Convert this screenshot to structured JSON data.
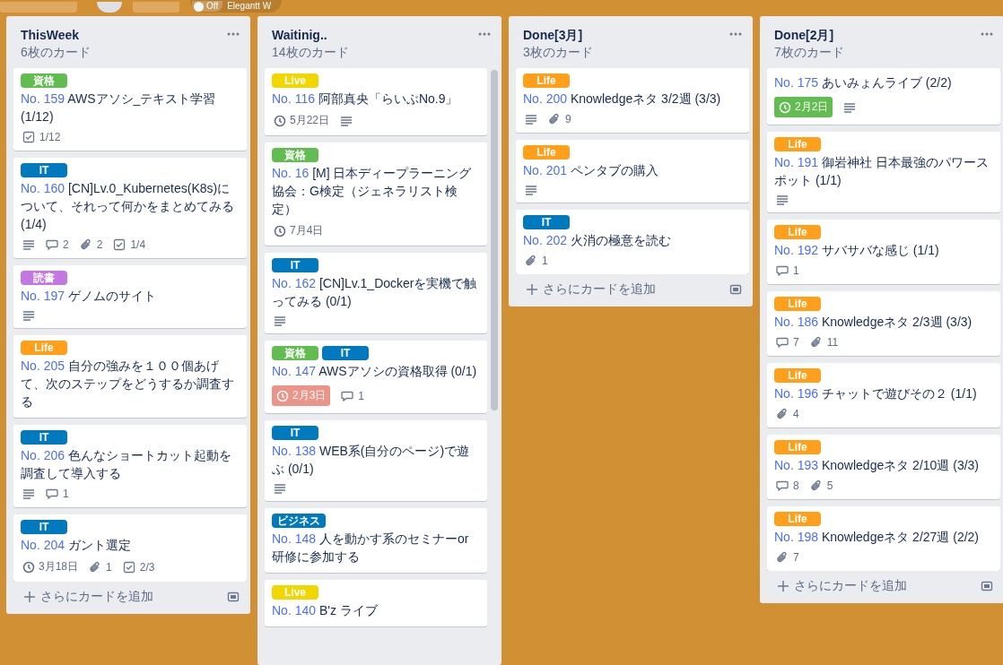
{
  "topbar": {
    "toggle": {
      "on": false,
      "state_text": "Off",
      "label": "Elegantt W"
    }
  },
  "lists": [
    {
      "title": "ThisWeek",
      "count": "6枚のカード",
      "add_card": "さらにカードを追加",
      "scrollable": false,
      "cards": [
        {
          "labels": [
            {
              "text": "資格",
              "color": "#61bd4f"
            }
          ],
          "number": "No. 159",
          "title": "AWSアソシ_テキスト学習 (1/12)",
          "badges": [
            {
              "kind": "checklist",
              "text": "1/12"
            }
          ]
        },
        {
          "labels": [
            {
              "text": "IT",
              "color": "#0079bf"
            }
          ],
          "number": "No. 160",
          "title": "[CN]Lv.0_Kubernetes(K8s)について、それって何かをまとめてみる (1/4)",
          "badges": [
            {
              "kind": "description"
            },
            {
              "kind": "comments",
              "text": "2"
            },
            {
              "kind": "attachments",
              "text": "2"
            },
            {
              "kind": "checklist",
              "text": "1/4"
            }
          ]
        },
        {
          "labels": [
            {
              "text": "読書",
              "color": "#c377e0"
            }
          ],
          "number": "No. 197",
          "title": "ゲノムのサイト",
          "badges": [
            {
              "kind": "description"
            }
          ]
        },
        {
          "labels": [
            {
              "text": "Life",
              "color": "#ff9f1a"
            }
          ],
          "number": "No. 205",
          "title": "自分の強みを１００個あげて、次のステップをどうするか調査する"
        },
        {
          "labels": [
            {
              "text": "IT",
              "color": "#0079bf"
            }
          ],
          "number": "No. 206",
          "title": "色んなショートカット起動を調査して導入する",
          "badges": [
            {
              "kind": "description"
            },
            {
              "kind": "comments",
              "text": "1"
            }
          ]
        },
        {
          "labels": [
            {
              "text": "IT",
              "color": "#0079bf"
            }
          ],
          "number": "No. 204",
          "title": "ガント選定",
          "badges": [
            {
              "kind": "due",
              "text": "3月18日"
            },
            {
              "kind": "attachments",
              "text": "1"
            },
            {
              "kind": "checklist",
              "text": "2/3"
            }
          ]
        }
      ]
    },
    {
      "title": "Waitinig..",
      "count": "14枚のカード",
      "scrollable": true,
      "cards": [
        {
          "labels": [
            {
              "text": "Live",
              "color": "#f2d600"
            }
          ],
          "number": "No. 116",
          "title": "阿部真央「らいぶNo.9」",
          "badges": [
            {
              "kind": "due",
              "text": "5月22日"
            },
            {
              "kind": "description"
            }
          ]
        },
        {
          "labels": [
            {
              "text": "資格",
              "color": "#61bd4f"
            }
          ],
          "number": "No. 16",
          "title": "[M] 日本ディープラーニング協会：G検定（ジェネラリスト検定）",
          "badges": [
            {
              "kind": "due",
              "text": "7月4日"
            }
          ]
        },
        {
          "labels": [
            {
              "text": "IT",
              "color": "#0079bf"
            }
          ],
          "number": "No. 162",
          "title": "[CN]Lv.1_Dockerを実機で触ってみる (0/1)",
          "badges": [
            {
              "kind": "description"
            }
          ]
        },
        {
          "labels": [
            {
              "text": "資格",
              "color": "#61bd4f"
            },
            {
              "text": "IT",
              "color": "#0079bf"
            }
          ],
          "number": "No. 147",
          "title": "AWSアソシの資格取得 (0/1)",
          "badges": [
            {
              "kind": "due_overdue",
              "text": "2月3日"
            },
            {
              "kind": "comments",
              "text": "1"
            }
          ]
        },
        {
          "labels": [
            {
              "text": "IT",
              "color": "#0079bf"
            }
          ],
          "number": "No. 138",
          "title": "WEB系(自分のページ)で遊ぶ (0/1)",
          "badges": [
            {
              "kind": "description"
            }
          ]
        },
        {
          "labels": [
            {
              "text": "ビジネス",
              "color": "#0079bf"
            }
          ],
          "number": "No. 148",
          "title": "人を動かす系のセミナーor研修に参加する"
        },
        {
          "labels": [
            {
              "text": "Live",
              "color": "#f2d600"
            }
          ],
          "number": "No. 140",
          "title": "B'z ライブ"
        }
      ]
    },
    {
      "title": "Done[3月]",
      "count": "3枚のカード",
      "add_card": "さらにカードを追加",
      "scrollable": false,
      "cards": [
        {
          "labels": [
            {
              "text": "Life",
              "color": "#ff9f1a"
            }
          ],
          "number": "No. 200",
          "title": "Knowledgeネタ 3/2週 (3/3)",
          "badges": [
            {
              "kind": "description"
            },
            {
              "kind": "attachments",
              "text": "9"
            }
          ]
        },
        {
          "labels": [
            {
              "text": "Life",
              "color": "#ff9f1a"
            }
          ],
          "number": "No. 201",
          "title": "ペンタブの購入",
          "badges": [
            {
              "kind": "description"
            }
          ]
        },
        {
          "labels": [
            {
              "text": "IT",
              "color": "#0079bf"
            }
          ],
          "number": "No. 202",
          "title": "火消の極意を読む",
          "badges": [
            {
              "kind": "attachments",
              "text": "1"
            }
          ]
        }
      ]
    },
    {
      "title": "Done[2月]",
      "count": "7枚のカード",
      "add_card": "さらにカードを追加",
      "scrollable": false,
      "cards": [
        {
          "number": "No. 175",
          "title": "あいみょんライブ (2/2)",
          "badges": [
            {
              "kind": "due_complete",
              "text": "2月2日"
            },
            {
              "kind": "description"
            }
          ]
        },
        {
          "labels": [
            {
              "text": "Life",
              "color": "#ff9f1a"
            }
          ],
          "number": "No. 191",
          "title": "御岩神社 日本最強のパワースポット (1/1)",
          "badges": [
            {
              "kind": "description"
            }
          ]
        },
        {
          "labels": [
            {
              "text": "Life",
              "color": "#ff9f1a"
            }
          ],
          "number": "No. 192",
          "title": "サバサバな感じ (1/1)",
          "badges": [
            {
              "kind": "comments",
              "text": "1"
            }
          ]
        },
        {
          "labels": [
            {
              "text": "Life",
              "color": "#ff9f1a"
            }
          ],
          "number": "No. 186",
          "title": "Knowledgeネタ 2/3週 (3/3)",
          "badges": [
            {
              "kind": "comments",
              "text": "7"
            },
            {
              "kind": "attachments",
              "text": "11"
            }
          ]
        },
        {
          "labels": [
            {
              "text": "Life",
              "color": "#ff9f1a"
            }
          ],
          "number": "No. 196",
          "title": "チャットで遊びその２ (1/1)",
          "badges": [
            {
              "kind": "attachments",
              "text": "4"
            }
          ]
        },
        {
          "labels": [
            {
              "text": "Life",
              "color": "#ff9f1a"
            }
          ],
          "number": "No. 193",
          "title": "Knowledgeネタ 2/10週 (3/3)",
          "badges": [
            {
              "kind": "comments",
              "text": "8"
            },
            {
              "kind": "attachments",
              "text": "5"
            }
          ]
        },
        {
          "labels": [
            {
              "text": "Life",
              "color": "#ff9f1a"
            }
          ],
          "number": "No. 198",
          "title": "Knowledgeネタ 2/27週 (2/2)",
          "badges": [
            {
              "kind": "attachments",
              "text": "7"
            }
          ]
        }
      ]
    }
  ]
}
